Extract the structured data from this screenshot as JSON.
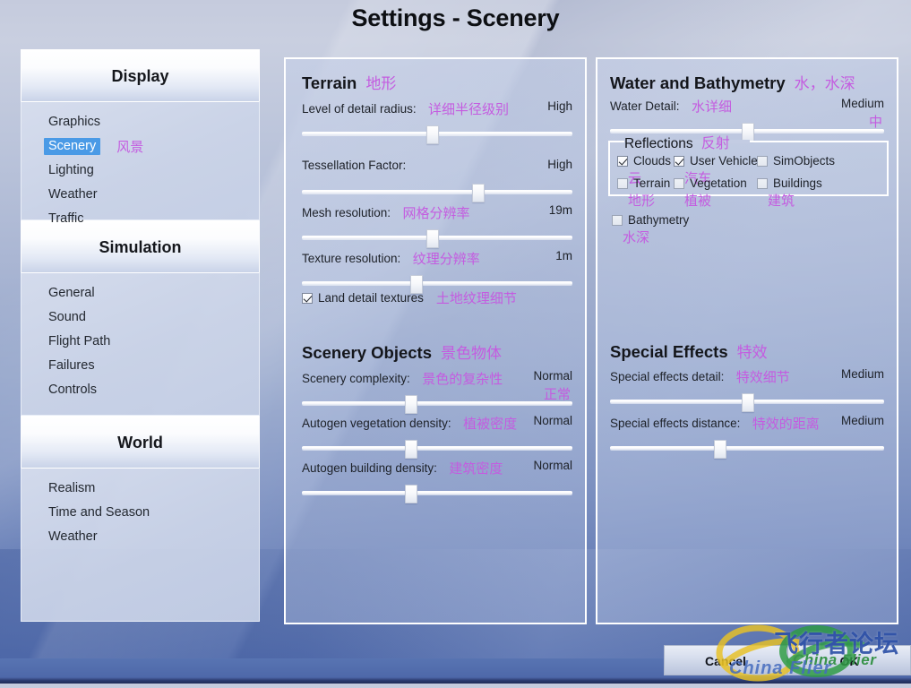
{
  "window": {
    "title": "Settings - Scenery"
  },
  "sidebar": {
    "groups": [
      {
        "header": "Display",
        "items": [
          {
            "label": "Graphics",
            "cn": "",
            "selected": false
          },
          {
            "label": "Scenery",
            "cn": "风景",
            "selected": true
          },
          {
            "label": "Lighting",
            "cn": "",
            "selected": false
          },
          {
            "label": "Weather",
            "cn": "",
            "selected": false
          },
          {
            "label": "Traffic",
            "cn": "",
            "selected": false
          }
        ]
      },
      {
        "header": "Simulation",
        "items": [
          {
            "label": "General",
            "cn": "",
            "selected": false
          },
          {
            "label": "Sound",
            "cn": "",
            "selected": false
          },
          {
            "label": "Flight Path",
            "cn": "",
            "selected": false
          },
          {
            "label": "Failures",
            "cn": "",
            "selected": false
          },
          {
            "label": "Controls",
            "cn": "",
            "selected": false
          }
        ]
      },
      {
        "header": "World",
        "items": [
          {
            "label": "Realism",
            "cn": "",
            "selected": false
          },
          {
            "label": "Time and Season",
            "cn": "",
            "selected": false
          },
          {
            "label": "Weather",
            "cn": "",
            "selected": false
          }
        ]
      }
    ]
  },
  "terrain": {
    "title": "Terrain",
    "title_cn": "地形",
    "sliders": [
      {
        "label": "Level of detail radius:",
        "cn": "详细半径级别",
        "value": "High",
        "value_cn": "",
        "pos": 48
      },
      {
        "label": "Tessellation Factor:",
        "cn": "",
        "value": "High",
        "value_cn": "",
        "pos": 65
      },
      {
        "label": "Mesh resolution:",
        "cn": "网格分辨率",
        "value": "19m",
        "value_cn": "",
        "pos": 48
      },
      {
        "label": "Texture resolution:",
        "cn": "纹理分辨率",
        "value": "1m",
        "value_cn": "",
        "pos": 42
      }
    ],
    "checkbox": {
      "label": "Land detail textures",
      "cn": "土地纹理细节",
      "checked": true
    }
  },
  "scenery_objects": {
    "title": "Scenery Objects",
    "title_cn": "景色物体",
    "sliders": [
      {
        "label": "Scenery complexity:",
        "cn": "景色的复杂性",
        "value": "Normal",
        "value_cn": "正常",
        "pos": 40
      },
      {
        "label": "Autogen vegetation density:",
        "cn": "植被密度",
        "value": "Normal",
        "value_cn": "",
        "pos": 40
      },
      {
        "label": "Autogen building density:",
        "cn": "建筑密度",
        "value": "Normal",
        "value_cn": "",
        "pos": 40
      }
    ]
  },
  "water": {
    "title": "Water and Bathymetry",
    "title_cn": "水，水深",
    "slider": {
      "label": "Water Detail:",
      "cn": "水详细",
      "value": "Medium",
      "value_cn": "中",
      "pos": 50
    },
    "reflections": {
      "title": "Reflections",
      "title_cn": "反射",
      "items": [
        {
          "label": "Clouds",
          "cn": "云",
          "checked": true,
          "dim": false
        },
        {
          "label": "User Vehicle",
          "cn": "汽车",
          "checked": true,
          "dim": false
        },
        {
          "label": "SimObjects",
          "cn": "",
          "checked": false,
          "dim": true
        },
        {
          "label": "Terrain",
          "cn": "地形",
          "checked": false,
          "dim": true
        },
        {
          "label": "Vegetation",
          "cn": "植被",
          "checked": false,
          "dim": true
        },
        {
          "label": "Buildings",
          "cn": "建筑",
          "checked": false,
          "dim": true
        }
      ]
    },
    "bathymetry": {
      "label": "Bathymetry",
      "cn": "水深",
      "checked": false
    }
  },
  "special_effects": {
    "title": "Special Effects",
    "title_cn": "特效",
    "sliders": [
      {
        "label": "Special effects detail:",
        "cn": "特效细节",
        "value": "Medium",
        "value_cn": "",
        "pos": 50
      },
      {
        "label": "Special effects distance:",
        "cn": "特效的距离",
        "value": "Medium",
        "value_cn": "",
        "pos": 40
      }
    ]
  },
  "buttons": {
    "cancel": "Cancel",
    "ok": "OK"
  },
  "watermark": {
    "text_cn": "飞行者论坛",
    "text_en": "China Flier",
    "text_en2": "China Flier"
  },
  "colors": {
    "accent_selected": "#4a9ae6",
    "annotation": "#c45ce0",
    "title_text": "#0d0f13",
    "panel_border": "#ffffff"
  }
}
